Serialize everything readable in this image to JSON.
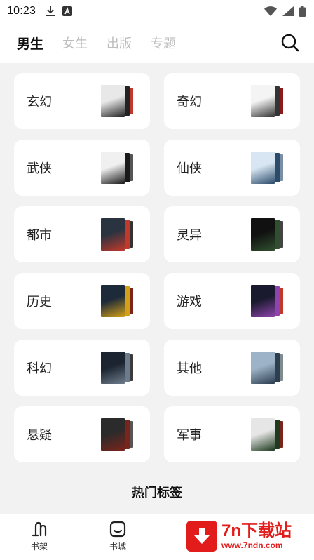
{
  "status_bar": {
    "time": "10:23"
  },
  "top_nav": {
    "tabs": [
      {
        "label": "男生",
        "active": true
      },
      {
        "label": "女生",
        "active": false
      },
      {
        "label": "出版",
        "active": false
      },
      {
        "label": "专题",
        "active": false
      }
    ]
  },
  "categories": [
    {
      "label": "玄幻",
      "cover_colors": [
        "#e8e8e8",
        "#222222",
        "#c0392b"
      ]
    },
    {
      "label": "奇幻",
      "cover_colors": [
        "#f4f4f4",
        "#333333",
        "#8b1a1a"
      ]
    },
    {
      "label": "武侠",
      "cover_colors": [
        "#f0f0f0",
        "#1a1a1a",
        "#555555"
      ]
    },
    {
      "label": "仙侠",
      "cover_colors": [
        "#d7e6f2",
        "#2b4b6b",
        "#7a8fa3"
      ]
    },
    {
      "label": "都市",
      "cover_colors": [
        "#2a3340",
        "#c0392b",
        "#333333"
      ]
    },
    {
      "label": "灵异",
      "cover_colors": [
        "#111111",
        "#2f4f2f",
        "#444444"
      ]
    },
    {
      "label": "历史",
      "cover_colors": [
        "#1d2a3a",
        "#d4a017",
        "#7b241c"
      ]
    },
    {
      "label": "游戏",
      "cover_colors": [
        "#1a1a2e",
        "#8e44ad",
        "#c0392b"
      ]
    },
    {
      "label": "科幻",
      "cover_colors": [
        "#1b2430",
        "#6d7c8c",
        "#3b3b3b"
      ]
    },
    {
      "label": "其他",
      "cover_colors": [
        "#9db4c8",
        "#2c3e50",
        "#7f8c8d"
      ]
    },
    {
      "label": "悬疑",
      "cover_colors": [
        "#2b2b2b",
        "#7b241c",
        "#555555"
      ]
    },
    {
      "label": "军事",
      "cover_colors": [
        "#e6e6e6",
        "#1f3a1f",
        "#7b241c"
      ]
    }
  ],
  "section_title": "热门标签",
  "bottom_bar": {
    "items": [
      {
        "label": "书架",
        "icon": "bookshelf-icon"
      },
      {
        "label": "书城",
        "icon": "bookstore-icon"
      }
    ]
  },
  "watermark": {
    "title": "7n下载站",
    "url": "www.7ndn.com"
  }
}
